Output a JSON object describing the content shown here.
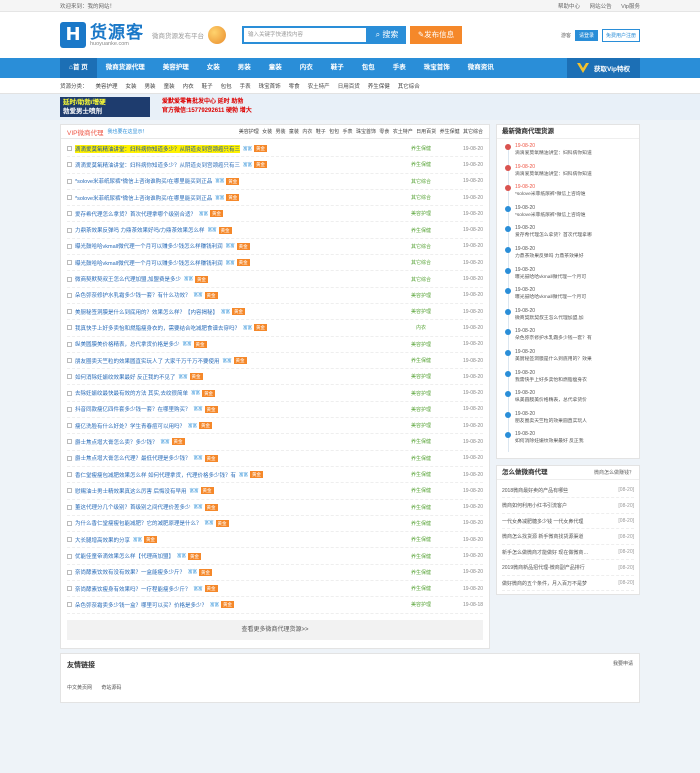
{
  "topbar": {
    "welcome": "欢迎来到：我的网站！",
    "links": [
      "帮助中心",
      "网站公告",
      "Vip服务"
    ]
  },
  "header": {
    "logo_cn": "货源客",
    "logo_en": "huoyuanke.com",
    "slogan": "微商货源发布平台",
    "search_placeholder": "输入关键字快速找内容",
    "search_button": "搜索",
    "publish_button": "发布信息",
    "login_label": "游客",
    "login_button": "请登录",
    "register_button": "免费用户注册"
  },
  "nav": {
    "items": [
      "首 页",
      "微商货源代理",
      "美容护理",
      "女装",
      "男装",
      "童装",
      "内衣",
      "鞋子",
      "包包",
      "手表",
      "珠宝首饰",
      "微商资讯"
    ],
    "vip": "获取Vip特权"
  },
  "catbar": {
    "label": "货源分类：",
    "items": [
      "美容护理",
      "女装",
      "男装",
      "童装",
      "内衣",
      "鞋子",
      "包包",
      "手表",
      "珠宝首饰",
      "零食",
      "农土特产",
      "日用百货",
      "养生保健",
      "其它综合"
    ]
  },
  "banner": {
    "ad1_line1": "延时/助勃/增硬",
    "ad1_line2": "勃爱男士喷剂",
    "ad2_line1": "爱默爱零售批发中心  延时 助勃",
    "ad2_line2": "官方微信:15779292611  硬勃 增大"
  },
  "vip_list": {
    "title": "VIP微商代理",
    "more": "我也要在这显示！",
    "tabs": [
      "美容护理",
      "女装",
      "男装",
      "童装",
      "内衣",
      "鞋子",
      "包包",
      "手表",
      "珠宝首饰",
      "零食",
      "农土特产",
      "日用百货",
      "养生保健",
      "其它综合"
    ],
    "tag_label": "富富",
    "tag2_label": "黄金",
    "rows": [
      {
        "title": "滴滴爱莫氧精油讲堂：妇科病你知道多少？从阴道炎到宫颈癌只有三",
        "cat": "养生保健",
        "date": "19-08-20",
        "hl": true
      },
      {
        "title": "滴滴爱莫氧精油讲堂：妇科病你知道多少？从阴道炎到宫颈癌只有三",
        "cat": "养生保健",
        "date": "19-08-20",
        "hl": false
      },
      {
        "title": "*solove米菲纸尿裤*微信上咨询谁购买/在哪里能买到正品",
        "cat": "其它综合",
        "date": "19-08-20",
        "hl": false
      },
      {
        "title": "*solove米菲纸尿裤*微信上咨询谁购买/在哪里能买到正品",
        "cat": "其它综合",
        "date": "19-08-20",
        "hl": false
      },
      {
        "title": "爱存希代理怎么拿货？首次代理拿哪个级别合适？",
        "cat": "美容护理",
        "date": "19-08-20",
        "hl": false
      },
      {
        "title": "力鼎茶效果反弹吗 力鼎茶效果好吗/力鼎茶效果怎么样",
        "cat": "养生保健",
        "date": "19-08-20",
        "hl": false
      },
      {
        "title": "曝光鼓哈哈vkmall微代理一个月可以赚多少钱怎么样赚钱利润",
        "cat": "其它综合",
        "date": "19-08-20",
        "hl": false
      },
      {
        "title": "曝光鼓哈哈vkmall微代理一个月可以赚多少钱怎么样赚钱利润",
        "cat": "其它综合",
        "date": "19-08-20",
        "hl": false
      },
      {
        "title": "微商契默契叔王怎么代理加盟,加盟费是多少",
        "cat": "其它综合",
        "date": "19-08-20",
        "hl": false
      },
      {
        "title": "朵色弥奈修护水乳霜多少钱一套？有什么功效？",
        "cat": "美容护理",
        "date": "19-08-20",
        "hl": false
      },
      {
        "title": "美厨秘签洞膜是什么到底用的？效果怎么样？【内容揭秘】",
        "cat": "美容护理",
        "date": "19-08-20",
        "hl": false
      },
      {
        "title": "我真快手上好多卖怡和燃脂瘦身衣的，需要结合吃减肥食谱去穿吗？",
        "cat": "内衣",
        "date": "19-08-20",
        "hl": false
      },
      {
        "title": "纵美圆膜美价格精表，总代拿货价格是多少",
        "cat": "美容护理",
        "date": "19-08-20",
        "hl": false
      },
      {
        "title": "朋友圈卖天竺粒的效果圆直实玩人了 大家千万千万不要使用",
        "cat": "养生保健",
        "date": "19-08-20",
        "hl": false
      },
      {
        "title": "如何消除妊娠纹效果最好 反正我的不见了",
        "cat": "美容护理",
        "date": "19-08-20",
        "hl": false
      },
      {
        "title": "去除妊娠纹最快最有效的方法 其实,去纹很简单",
        "cat": "美容护理",
        "date": "19-08-20",
        "hl": false
      },
      {
        "title": "抖音同款瘦亿四件套多少钱一套？在哪里购买？",
        "cat": "美容护理",
        "date": "19-08-20",
        "hl": false
      },
      {
        "title": "瘦亿洗脸有什么好处？学生青春痘可以用吗？",
        "cat": "美容护理",
        "date": "19-08-20",
        "hl": false
      },
      {
        "title": "爵士焦点增大膏怎么卖？多少钱？",
        "cat": "养生保健",
        "date": "19-08-20",
        "hl": false
      },
      {
        "title": "爵士焦点增大膏怎么代理？最低代理是多少钱？",
        "cat": "养生保健",
        "date": "19-08-20",
        "hl": false
      },
      {
        "title": "香仁堂瘦瘦包减肥效果怎么样 如何代理拿货，代理价格多少钱？有",
        "cat": "养生保健",
        "date": "19-08-20",
        "hl": false
      },
      {
        "title": "慰赐油士男士精效果真这么厉害 后悔没有早用",
        "cat": "养生保健",
        "date": "19-08-20",
        "hl": false
      },
      {
        "title": "董这代理分几个级别？首级别之间代理价差多少",
        "cat": "养生保健",
        "date": "19-08-20",
        "hl": false
      },
      {
        "title": "为什么香仁堂瘦瘦包能减肥？它的减肥原理是什么？",
        "cat": "养生保健",
        "date": "19-08-20",
        "hl": false
      },
      {
        "title": "大长腿增高效果的分享",
        "cat": "养生保健",
        "date": "19-08-20",
        "hl": false
      },
      {
        "title": "优能佳童帝滴效果怎么样【代理商加盟】",
        "cat": "养生保健",
        "date": "19-08-20",
        "hl": false
      },
      {
        "title": "奈尚酵素饮效有没有效果？一盒能瘦多少斤？",
        "cat": "养生保健",
        "date": "19-08-20",
        "hl": false
      },
      {
        "title": "奈尚酵素饮瘦身有效果吗？一疗程能瘦多少斤？",
        "cat": "养生保健",
        "date": "19-08-20",
        "hl": false
      },
      {
        "title": "朵色弥奈霜卖多少钱一盒？哪里可以买？价格是多少？",
        "cat": "美容护理",
        "date": "19-08-18",
        "hl": false
      }
    ],
    "view_more": "查看更多微商代理货源>>"
  },
  "latest": {
    "title": "最新微商代理货源",
    "items": [
      {
        "date": "19-08-20",
        "text": "滴滴爱莫氧精油讲堂：妇科病你知道",
        "red": true
      },
      {
        "date": "19-08-20",
        "text": "滴滴爱莫氧精油讲堂：妇科病你知道",
        "red": true
      },
      {
        "date": "19-08-20",
        "text": "*solove米菲纸尿裤*微信上咨询谁",
        "red": true
      },
      {
        "date": "19-08-20",
        "text": "*solove米菲纸尿裤*微信上咨询谁",
        "red": false
      },
      {
        "date": "19-08-20",
        "text": "爱存希代理怎么拿货？首次代理拿哪",
        "red": false
      },
      {
        "date": "19-08-20",
        "text": "力鼎茶效果反弹吗 力鼎茶效果好",
        "red": false
      },
      {
        "date": "19-08-20",
        "text": "曝光鼓哈哈vkmall微代理一个月可",
        "red": false
      },
      {
        "date": "19-08-20",
        "text": "曝光鼓哈哈vkmall微代理一个月可",
        "red": false
      },
      {
        "date": "19-08-20",
        "text": "微商契默契叔王怎么代理加盟,加",
        "red": false
      },
      {
        "date": "19-08-20",
        "text": "朵色弥奈修护水乳霜多少钱一套？有",
        "red": false
      },
      {
        "date": "19-08-20",
        "text": "美厨秘签洞膜是什么到底用的？效果",
        "red": false
      },
      {
        "date": "19-08-20",
        "text": "我需快手上好多卖怡和燃脂瘦身衣",
        "red": false
      },
      {
        "date": "19-08-20",
        "text": "纵美圆膜美价格精表，总代拿货价",
        "red": false
      },
      {
        "date": "19-08-20",
        "text": "朋友圈卖天竺粒的效果圆直实玩人",
        "red": false
      },
      {
        "date": "19-08-20",
        "text": "如何消除妊娠纹效果最好 反正我",
        "red": false
      }
    ]
  },
  "howto": {
    "title": "怎么做微商代理",
    "sub": "微商怎么做赚钱？",
    "items": [
      {
        "text": "2018微商最好卖的产品有哪些",
        "date": "[08-20]"
      },
      {
        "text": "微商如何利用小红书引流客户",
        "date": "[08-20]"
      },
      {
        "text": "一代女鼻减肥糖多少钱 一代女鼻代理",
        "date": "[08-20]"
      },
      {
        "text": "微商怎么找货源 新手微商找货源渠道",
        "date": "[08-20]"
      },
      {
        "text": "新手怎么做微商才能做好 现在做微商…",
        "date": "[08-20]"
      },
      {
        "text": "2019微商新品招代理-微商副产品排行",
        "date": "[08-20]"
      },
      {
        "text": "做好微商的五个条件，月入百万不是梦",
        "date": "[08-20]"
      }
    ]
  },
  "friends": {
    "title": "友情链接",
    "apply": "我要申请",
    "links": [
      "中文黄页网",
      "奇站源码"
    ]
  }
}
